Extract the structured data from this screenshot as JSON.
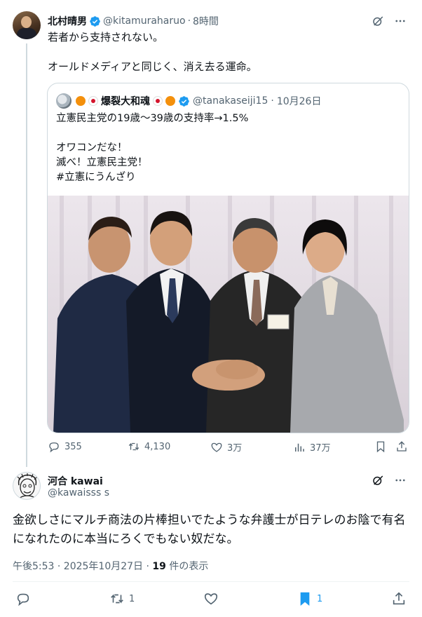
{
  "post": {
    "author_name": "北村晴男",
    "handle": "@kitamuraharuo",
    "separator": "·",
    "time": "8時間",
    "text_lines": [
      "若者から支持されない。",
      "",
      "オールドメディアと同じく、消え去る運命。"
    ],
    "quote": {
      "author_name": "爆裂大和魂",
      "handle": "@tanakaseiji15",
      "separator": "·",
      "date": "10月26日",
      "text_lines": [
        "立憲民主党の19歳〜39歳の支持率→1.5%",
        "",
        "オワコンだな！",
        "滅べ！立憲民主党！",
        "#立憲にうんざり"
      ]
    },
    "stats": {
      "replies": "355",
      "reposts": "4,130",
      "likes": "3万",
      "views": "37万"
    }
  },
  "reply": {
    "author_name": "河合 kawai",
    "handle": "@kawaisss s",
    "text": "金欲しさにマルチ商法の片棒担いでたような弁護士が日テレのお陰で有名になれたのに本当にろくでもない奴だな。",
    "timestamp": "午後5:53 · 2025年10月27日 ·",
    "view_count": "19",
    "view_label": "件の表示",
    "stats": {
      "reposts": "1",
      "bookmarks": "1"
    }
  },
  "colors": {
    "accent": "#1d9bf0",
    "muted": "#536471",
    "border": "#cfd9de"
  },
  "icons": [
    "verified-badge-icon",
    "grok-icon",
    "more-icon",
    "reply-icon",
    "repost-icon",
    "like-icon",
    "views-icon",
    "bookmark-icon",
    "share-icon"
  ]
}
